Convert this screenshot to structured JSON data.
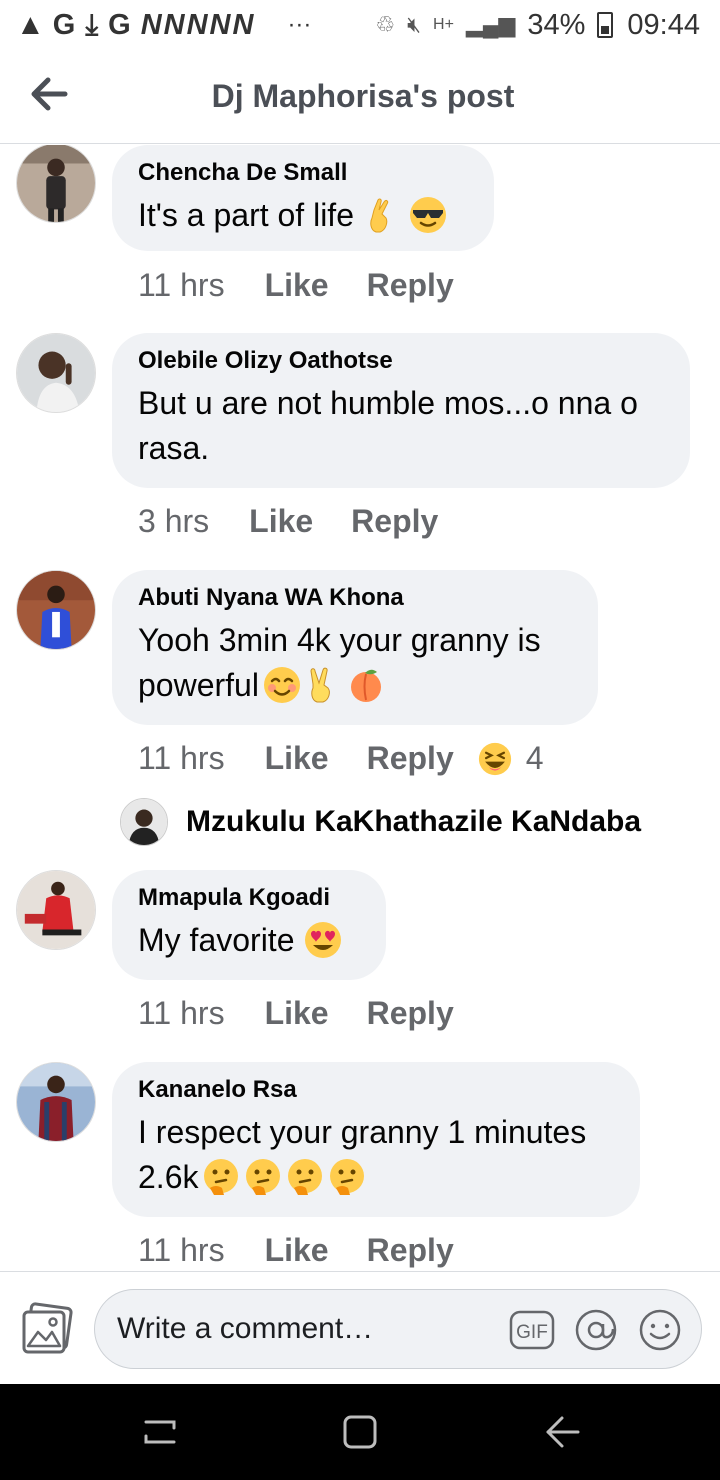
{
  "status_bar": {
    "left_glyphs": "▲ G",
    "left_letters": "G",
    "left_nn": "NNNNN",
    "dots": "···",
    "battery": "34%",
    "time": "09:44"
  },
  "header": {
    "title": "Dj Maphorisa's post"
  },
  "comments": [
    {
      "author": "Chencha De Small",
      "text": "It's a part of life",
      "emojis": [
        "crossed-fingers",
        "sunglasses"
      ],
      "time": "11 hrs",
      "like": "Like",
      "reply": "Reply"
    },
    {
      "author": "Olebile Olizy Oathotse",
      "text": "But u are not humble mos...o nna o rasa.",
      "emojis": [],
      "time": "3 hrs",
      "like": "Like",
      "reply": "Reply"
    },
    {
      "author": "Abuti Nyana WA Khona",
      "text_line1": "Yooh 3min 4k  your granny is",
      "text_line2": "powerful",
      "emojis": [
        "smiling-blush",
        "victory-hand",
        "peach"
      ],
      "time": "11 hrs",
      "like": "Like",
      "reply": "Reply",
      "reaction_count": "4",
      "reply_preview_name": "Mzukulu KaKhathazile KaNdaba"
    },
    {
      "author": "Mmapula Kgoadi",
      "text": "My favorite",
      "emojis": [
        "heart-eyes"
      ],
      "time": "11 hrs",
      "like": "Like",
      "reply": "Reply"
    },
    {
      "author": "Kananelo Rsa",
      "text_line1": "I respect your granny 1 minutes",
      "text_line2": "2.6k",
      "emojis": [
        "thinking",
        "thinking",
        "thinking",
        "thinking"
      ],
      "time": "11 hrs",
      "like": "Like",
      "reply": "Reply"
    }
  ],
  "composer": {
    "placeholder": "Write a comment…",
    "gif_label": "GIF"
  },
  "colors": {
    "bubble": "#f0f2f5",
    "meta_text": "#65676b",
    "title_text": "#4b4f56"
  }
}
